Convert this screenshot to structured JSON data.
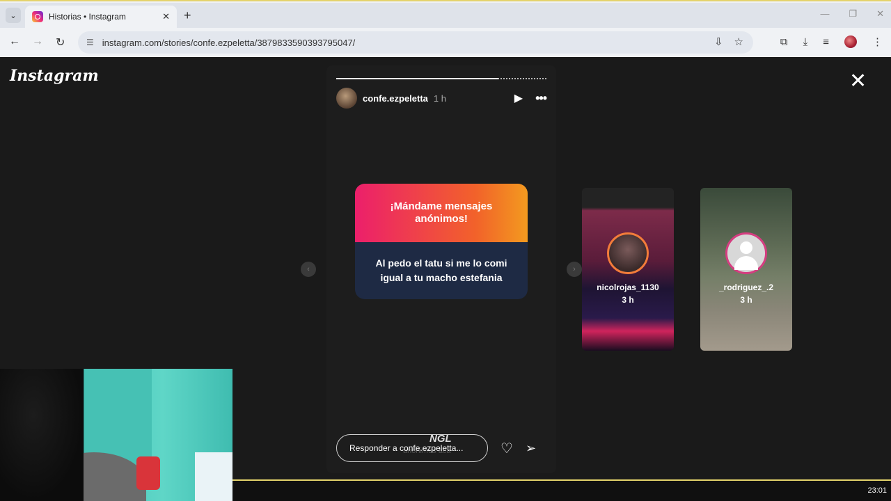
{
  "browser": {
    "tab_title": "Historias • Instagram",
    "url": "instagram.com/stories/confe.ezpeletta/3879833590393795047/"
  },
  "instagram": {
    "logo": "Instagram",
    "story": {
      "username": "confe.ezpeletta",
      "time": "1 h",
      "progress_fraction": 0.77,
      "ngl_title": "¡Mándame mensajes anónimos!",
      "ngl_message": "Al pedo el tatu si me lo comi igual a tu macho estefania",
      "ngl_brand": "NGL",
      "ngl_faint_text": "anónimos aca",
      "reply_placeholder": "Responder a confe.ezpeletta..."
    },
    "previews": [
      {
        "username": "nicolrojas_1130",
        "time": "3 h"
      },
      {
        "username": "_rodriguez_.2",
        "time": "3 h"
      }
    ]
  },
  "taskbar": {
    "clock": "23:01"
  },
  "colors": {
    "ngl_gradient_start": "#ec1f6b",
    "ngl_gradient_end": "#f39a1f",
    "ngl_bottom": "#1e2a44"
  }
}
